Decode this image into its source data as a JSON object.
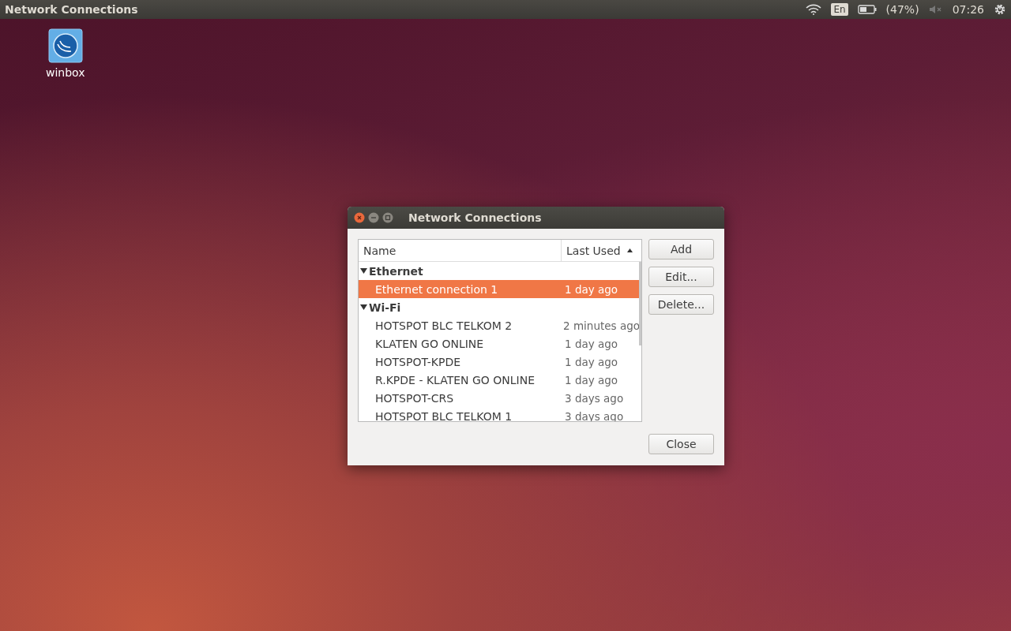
{
  "top_panel": {
    "title": "Network Connections",
    "keyboard": "En",
    "battery": "(47%)",
    "time": "07:26"
  },
  "desktop_icons": [
    {
      "label": "winbox"
    }
  ],
  "window": {
    "title": "Network Connections",
    "table": {
      "columns": [
        {
          "label": "Name",
          "sorted": false
        },
        {
          "label": "Last Used",
          "sorted": true
        }
      ],
      "groups": [
        {
          "label": "Ethernet",
          "expanded": true,
          "children": [
            {
              "name": "Ethernet connection 1",
              "last_used": "1 day ago",
              "selected": true
            }
          ]
        },
        {
          "label": "Wi-Fi",
          "expanded": true,
          "children": [
            {
              "name": "HOTSPOT BLC TELKOM 2",
              "last_used": "2 minutes ago",
              "selected": false
            },
            {
              "name": "KLATEN GO ONLINE",
              "last_used": "1 day ago",
              "selected": false
            },
            {
              "name": "HOTSPOT-KPDE",
              "last_used": "1 day ago",
              "selected": false
            },
            {
              "name": "R.KPDE - KLATEN GO ONLINE",
              "last_used": "1 day ago",
              "selected": false
            },
            {
              "name": "HOTSPOT-CRS",
              "last_used": "3 days ago",
              "selected": false
            },
            {
              "name": "HOTSPOT BLC TELKOM 1",
              "last_used": "3 days ago",
              "selected": false
            }
          ]
        }
      ]
    },
    "side_buttons": [
      "Add",
      "Edit...",
      "Delete..."
    ],
    "close_button": "Close"
  }
}
